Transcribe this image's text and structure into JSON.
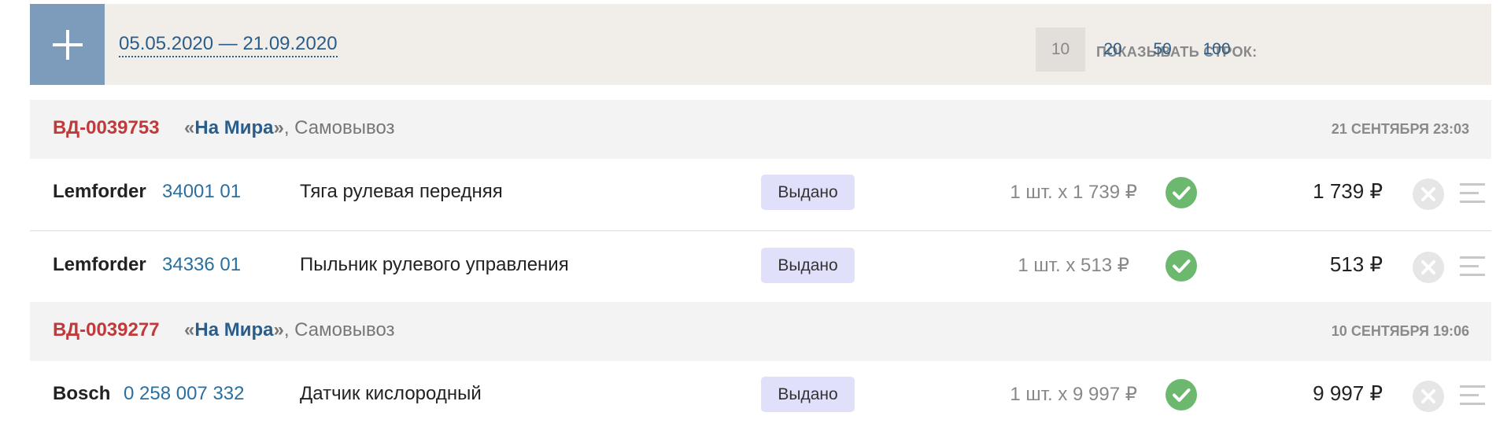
{
  "filter": {
    "add_icon": "plus-icon",
    "date_range": "05.05.2020 — 21.09.2020",
    "rows_label": "ПОКАЗЫВАТЬ СТРОК:",
    "rows_options": [
      "10",
      "20",
      "50",
      "100"
    ],
    "rows_selected": "10"
  },
  "orders": [
    {
      "id": "ВД-0039753",
      "store_quote_open": "«",
      "store": "На Мира",
      "store_quote_close": "»",
      "delivery": ", Самовывоз",
      "date": "21 СЕНТЯБРЯ 23:03",
      "items": [
        {
          "brand": "Lemforder",
          "article": "34001 01",
          "name": "Тяга рулевая передняя",
          "status": "Выдано",
          "qty_price": "1 шт. х 1 739 ₽",
          "total": "1 739 ₽"
        },
        {
          "brand": "Lemforder",
          "article": "34336 01",
          "name": "Пыльник рулевого управления",
          "status": "Выдано",
          "qty_price": "1 шт. х 513 ₽",
          "total": "513 ₽"
        }
      ]
    },
    {
      "id": "ВД-0039277",
      "store_quote_open": "«",
      "store": "На Мира",
      "store_quote_close": "»",
      "delivery": ", Самовывоз",
      "date": "10 СЕНТЯБРЯ 19:06",
      "items": [
        {
          "brand": "Bosch",
          "article": "0 258 007 332",
          "name": "Датчик кислородный",
          "status": "Выдано",
          "qty_price": "1 шт. х 9 997 ₽",
          "total": "9 997 ₽"
        }
      ]
    }
  ],
  "icons": {
    "confirmed": "check-circle-icon",
    "cancel": "cancel-circle-icon",
    "menu": "menu-lines-icon"
  },
  "colors": {
    "order_id": "#c0393b",
    "link": "#2b5d8a",
    "status_bg": "#e0e0fa",
    "check": "#6cb86e",
    "add_button": "#7d9cbb"
  }
}
